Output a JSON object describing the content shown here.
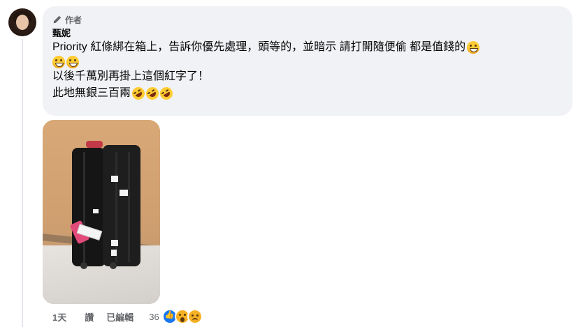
{
  "comment": {
    "badge_label": "作者",
    "author": "甄妮",
    "lines": [
      "Priority 紅條綁在箱上，告訴你優先處理，頭等的，並暗示 請打開隨便偷 都是值錢的",
      "以後千萬別再掛上這個紅字了！",
      "此地無銀三百兩"
    ],
    "emoji": {
      "line1_end": "grinning-face-with-smiling-eyes",
      "line1_cont": [
        "grinning-face-with-smiling-eyes",
        "grinning-face-with-smiling-eyes"
      ],
      "line3_end": [
        "rolling-on-floor-laughing",
        "rolling-on-floor-laughing",
        "rolling-on-floor-laughing"
      ]
    }
  },
  "footer": {
    "time": "1天",
    "like_label": "讚",
    "edited_label": "已編輯",
    "reaction_count": "36",
    "reactions": [
      "like",
      "wow",
      "sad"
    ]
  },
  "colors": {
    "bubble_bg": "#f0f2f5",
    "secondary_text": "#65676b",
    "like_blue": "#1877f2"
  }
}
